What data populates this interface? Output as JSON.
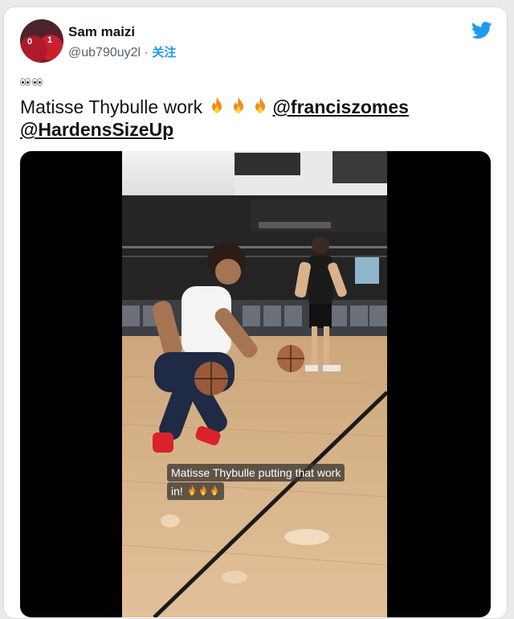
{
  "tweet": {
    "author_name": "Sam maizi",
    "handle": "@ub790uy2l",
    "separator": "·",
    "follow_label": "关注",
    "emoji_prefix": "👀👀",
    "text": "Matisse Thybulle work ",
    "fire_emojis": "🔥🔥🔥",
    "mention_1": "@franciszomes",
    "mention_2": "@HardensSizeUp"
  },
  "video": {
    "caption_line_1": "Matisse Thybulle putting that work",
    "caption_line_2": "in!",
    "caption_fires": "🔥🔥🔥"
  },
  "colors": {
    "twitter_blue": "#1d9bf0",
    "text_primary": "#0f1419",
    "text_secondary": "#536471"
  },
  "icons": {
    "brand": "twitter-bird-icon"
  }
}
